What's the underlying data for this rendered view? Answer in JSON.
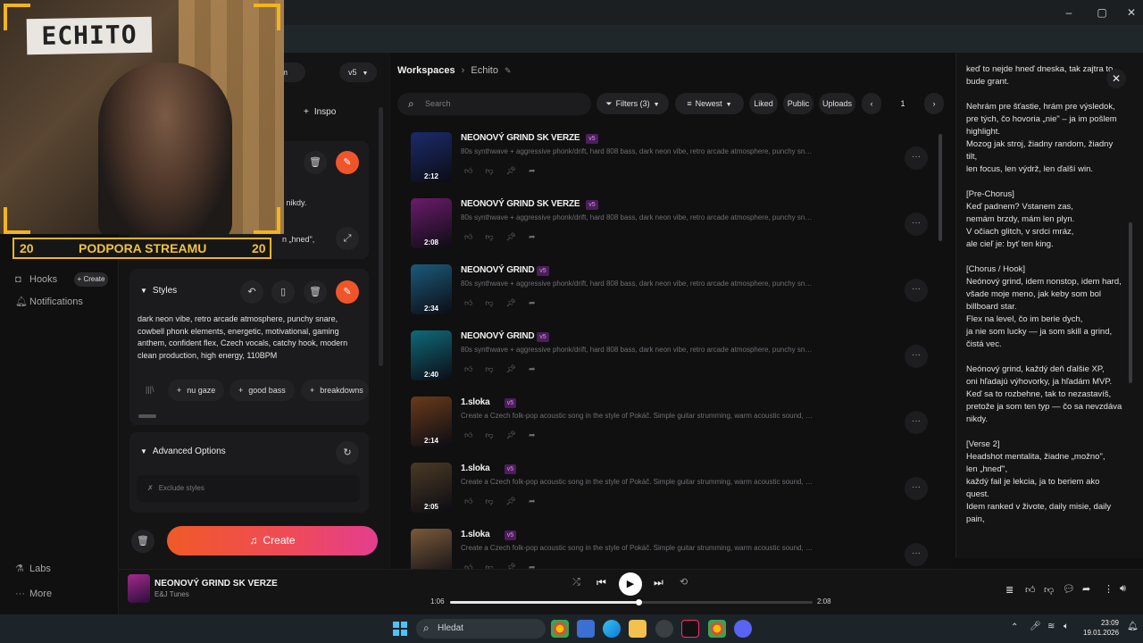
{
  "support_banner": {
    "left_number": "20",
    "text": "PODPORA STREAMU",
    "right_number": "20"
  },
  "webcam_sign": "ECHITO",
  "create_panel": {
    "version_label": "v5",
    "inspo_label": "Inspo",
    "partial_label": "m",
    "lyrics_snippet_1": "a nikdy.",
    "lyrics_snippet_2": "n „hned\",",
    "styles_title": "Styles",
    "styles_text": "dark neon vibe, retro arcade atmosphere, punchy snare, cowbell phonk elements, energetic, motivational, gaming anthem, confident flex, Czech vocals, catchy hook, modern clean production, high energy, 110BPM",
    "style_chips": [
      "nu gaze",
      "good bass",
      "breakdowns"
    ],
    "advanced_title": "Advanced Options",
    "exclude_placeholder": "Exclude styles",
    "create_label": "Create"
  },
  "left_nav": {
    "hooks_label": "Hooks",
    "hooks_create": "+ Create",
    "notifications_label": "Notifications",
    "labs_label": "Labs",
    "more_label": "More"
  },
  "workspace": {
    "breadcrumb_root": "Workspaces",
    "breadcrumb_current": "Echito",
    "search_placeholder": "Search",
    "filters_label": "Filters (3)",
    "sort_label": "Newest",
    "liked_label": "Liked",
    "public_label": "Public",
    "uploads_label": "Uploads",
    "page_number": "1",
    "songs": [
      {
        "title": "NEONOVÝ GRIND SK VERZE",
        "version": "v5",
        "duration": "2:12",
        "desc": "80s synthwave + aggressive phonk/drift, hard 808 bass, dark neon vibe, retro arcade atmosphere, punchy snare, co...",
        "thumb_color": "#1b2b6b"
      },
      {
        "title": "NEONOVÝ GRIND SK VERZE",
        "version": "v5",
        "duration": "2:08",
        "desc": "80s synthwave + aggressive phonk/drift, hard 808 bass, dark neon vibe, retro arcade atmosphere, punchy snare, co...",
        "thumb_color": "#6b1b6a"
      },
      {
        "title": "NEONOVÝ GRIND",
        "version": "v5",
        "duration": "2:34",
        "desc": "80s synthwave + aggressive phonk/drift, hard 808 bass, dark neon vibe, retro arcade atmosphere, punchy snare, co...",
        "thumb_color": "#1b5a7a"
      },
      {
        "title": "NEONOVÝ GRIND",
        "version": "v5",
        "duration": "2:40",
        "desc": "80s synthwave + aggressive phonk/drift, hard 808 bass, dark neon vibe, retro arcade atmosphere, punchy snare, co...",
        "thumb_color": "#0e6a7a"
      },
      {
        "title": "1.sloka",
        "version": "v5",
        "duration": "2:14",
        "desc": "Create a Czech folk-pop acoustic song in the style of Pokáč. Simple guitar strumming, warm acoustic sound, light pe...",
        "thumb_color": "#6a3a1a"
      },
      {
        "title": "1.sloka",
        "version": "v5",
        "duration": "2:05",
        "desc": "Create a Czech folk-pop acoustic song in the style of Pokáč. Simple guitar strumming, warm acoustic sound, light pe...",
        "thumb_color": "#4a3a24"
      },
      {
        "title": "1.sloka",
        "version": "v5",
        "duration": "",
        "desc": "Create a Czech folk-pop acoustic song in the style of Pokáč. Simple guitar strumming, warm acoustic sound, light pe...",
        "thumb_color": "#7a5a3a"
      }
    ]
  },
  "lyrics_panel": {
    "text": "keď to nejde hneď dneska, tak zajtra to bude grant.\n\nNehrám pre šťastie, hrám pre výsledok,\npre tých, čo hovoria „nie\" – ja im pošlem highlight.\nMozog jak stroj, žiadny random, žiadny tilt,\nlen focus, len výdrž, len ďalší win.\n\n[Pre-Chorus]\nKeď padnem? Vstanem zas,\nnemám brzdy, mám len plyn.\nV očiach glitch, v srdci mráz,\nale cieľ je: byť ten king.\n\n[Chorus / Hook]\nNeónový grind, idem nonstop, idem hard,\nvšade moje meno, jak keby som bol billboard star.\nFlex na level, čo im berie dych,\nja nie som lucky — ja som skill a grind, čistá vec.\n\nNeónový grind, každý deň ďalšie XP,\noni hľadajú výhovorky, ja hľadám MVP.\nKeď sa to rozbehne, tak to nezastavíš,\npretože ja som ten typ — čo sa nevzdáva nikdy.\n\n[Verse 2]\nHeadshot mentalita, žiadne „možno\",\nlen „hneď\",\nkaždý fail je lekcia, ja to beriem ako quest.\nIdem ranked v živote, daily misie, daily pain,"
  },
  "player": {
    "title": "NEONOVÝ GRIND SK VERZE",
    "artist": "E&J Tunes",
    "current_time": "1:06",
    "total_time": "2:08",
    "progress": 0.52
  },
  "taskbar": {
    "search_placeholder": "Hledat",
    "time": "23:09",
    "date": "19.01.2026"
  },
  "colors": {
    "accent_orange": "#f0552a",
    "accent_pink": "#e43e8f",
    "banner_yellow": "#f2b51c",
    "version_badge": "#e38bf1"
  }
}
